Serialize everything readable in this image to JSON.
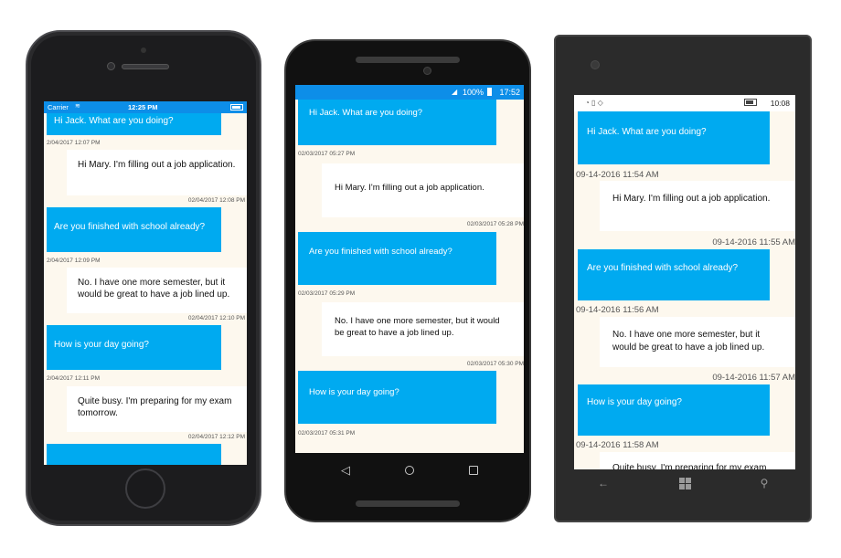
{
  "iphone": {
    "status": {
      "carrier": "Carrier",
      "time": "12:25 PM"
    },
    "messages": [
      {
        "type": "in",
        "text": "Hi Jack.  What are you doing?",
        "timestamp": "2/04/2017 12:07 PM"
      },
      {
        "type": "out",
        "text": "Hi Mary.  I'm filling out a job application.",
        "timestamp": "02/04/2017 12:08 PM"
      },
      {
        "type": "in",
        "text": "Are you finished with school already?",
        "timestamp": "2/04/2017 12:09 PM"
      },
      {
        "type": "out",
        "text": "No.  I have one more semester, but it would be great to have a job lined up.",
        "timestamp": "02/04/2017 12:10 PM"
      },
      {
        "type": "in",
        "text": "How is your day going?",
        "timestamp": "2/04/2017 12:11 PM"
      },
      {
        "type": "out",
        "text": "Quite busy.  I'm preparing for my exam tomorrow.",
        "timestamp": "02/04/2017 12:12 PM"
      }
    ]
  },
  "android": {
    "status": {
      "battery": "100%",
      "time": "17:52"
    },
    "messages": [
      {
        "type": "in",
        "text": "Hi Jack.  What are you doing?",
        "timestamp": "02/03/2017 05:27 PM"
      },
      {
        "type": "out",
        "text": "Hi Mary.  I'm filling out a job application.",
        "timestamp": "02/03/2017 05:28 PM"
      },
      {
        "type": "in",
        "text": "Are you finished with school already?",
        "timestamp": "02/03/2017 05:29 PM"
      },
      {
        "type": "out",
        "text": "No.  I have one more semester, but it would be great to have a job lined up.",
        "timestamp": "02/03/2017 05:30 PM"
      },
      {
        "type": "in",
        "text": "How is your day going?",
        "timestamp": "02/03/2017 05:31 PM"
      }
    ]
  },
  "winphone": {
    "status": {
      "time": "10:08"
    },
    "messages": [
      {
        "type": "in",
        "text": "Hi Jack.  What are you doing?",
        "timestamp": "09-14-2016 11:54 AM"
      },
      {
        "type": "out",
        "text": "Hi Mary.  I'm filling out a job application.",
        "timestamp": "09-14-2016 11:55 AM"
      },
      {
        "type": "in",
        "text": "Are you finished with school already?",
        "timestamp": "09-14-2016 11:56 AM"
      },
      {
        "type": "out",
        "text": "No.  I have one more semester, but it would be great to have a job lined up.",
        "timestamp": "09-14-2016 11:57 AM"
      },
      {
        "type": "in",
        "text": "How is your day going?",
        "timestamp": "09-14-2016 11:58 AM"
      },
      {
        "type": "out",
        "text": "Quite busy.  I'm preparing for my exam",
        "timestamp": ""
      }
    ]
  },
  "colors": {
    "incoming_bubble": "#00aaf0",
    "outgoing_bubble": "#ffffff",
    "chat_background": "#fdf8ee",
    "status_bar": "#0d8ee8"
  }
}
